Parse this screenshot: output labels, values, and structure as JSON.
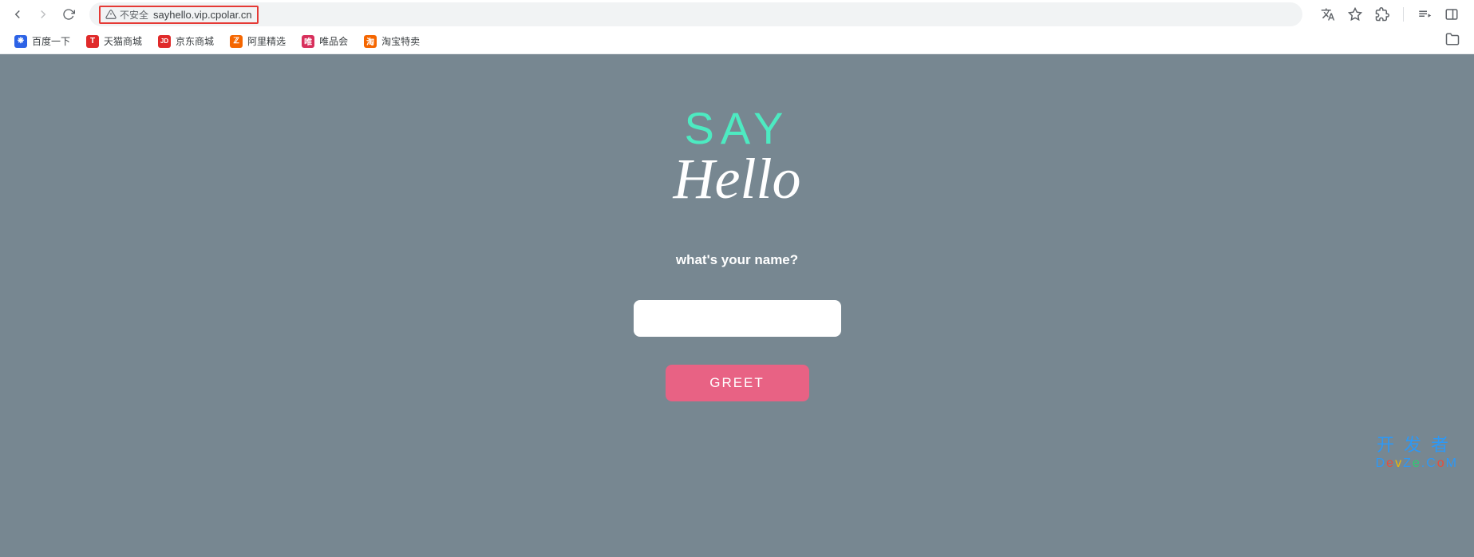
{
  "browser": {
    "security_label": "不安全",
    "url": "sayhello.vip.cpolar.cn"
  },
  "bookmarks": [
    {
      "label": "百度一下",
      "icon_bg": "#2d63e6",
      "icon_text": "❋"
    },
    {
      "label": "天猫商城",
      "icon_bg": "#e02a2a",
      "icon_text": "T"
    },
    {
      "label": "京东商城",
      "icon_bg": "#e02a2a",
      "icon_text": "JD"
    },
    {
      "label": "阿里精选",
      "icon_bg": "#f56600",
      "icon_text": "ℤ"
    },
    {
      "label": "唯品会",
      "icon_bg": "#d8305c",
      "icon_text": "唯"
    },
    {
      "label": "淘宝特卖",
      "icon_bg": "#f56600",
      "icon_text": "淘"
    }
  ],
  "page": {
    "title_top": "SAY",
    "title_bottom": "Hello",
    "prompt": "what's your name?",
    "input_value": "",
    "button_label": "GREET"
  },
  "watermark": {
    "line1": "开发者",
    "line2": "DevZe.CoM"
  },
  "colors": {
    "page_bg": "#778791",
    "accent_green": "#4deac1",
    "accent_pink": "#e86284"
  }
}
